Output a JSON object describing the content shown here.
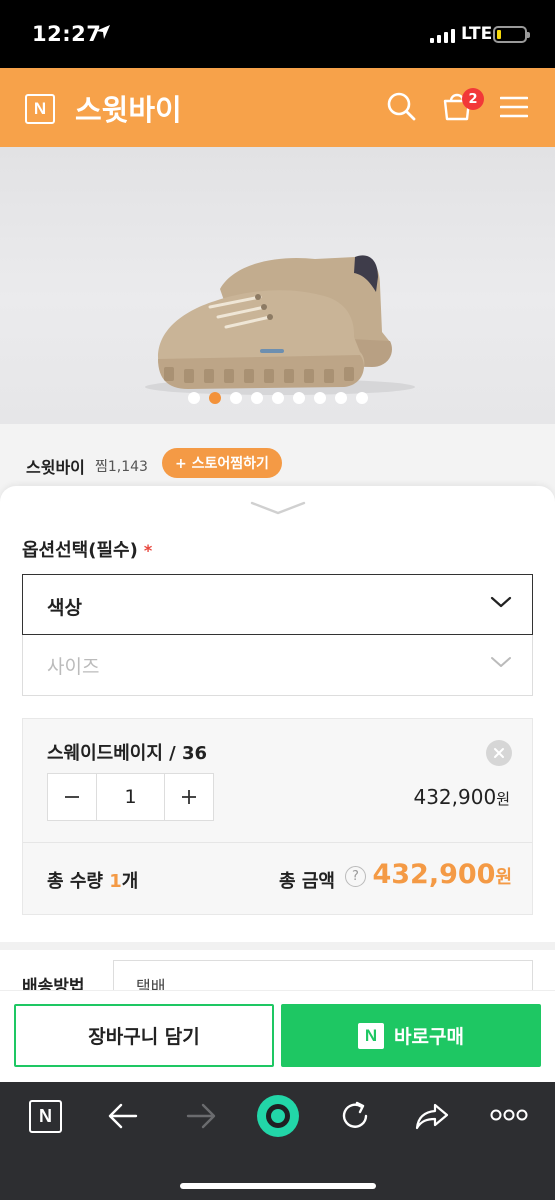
{
  "status_bar": {
    "time": "12:27",
    "network": "LTE"
  },
  "header": {
    "logo": "N",
    "title": "스윗바이",
    "cart_count": "2"
  },
  "hero": {
    "slide_count": 9,
    "active_index": 1
  },
  "store": {
    "name": "스윗바이",
    "likes": "찜1,143",
    "follow_label": "+ 스토어찜하기"
  },
  "options": {
    "title": "옵션선택(필수)",
    "required_mark": "*",
    "color_label": "색상",
    "size_label": "사이즈"
  },
  "selected_item": {
    "name": "스웨이드베이지 / 36",
    "quantity": "1",
    "price": "432,900",
    "price_unit": "원"
  },
  "totals": {
    "qty_label": "총 수량",
    "qty_value": "1",
    "qty_unit": "개",
    "amount_label": "총 금액",
    "help": "?",
    "amount": "432,900",
    "amount_unit": "원"
  },
  "shipping": {
    "label": "배송방법",
    "value": "택배"
  },
  "actions": {
    "cart_label": "장바구니 담기",
    "buy_logo": "N",
    "buy_label": "바로구매"
  },
  "browser_toolbar": {
    "logo": "N",
    "icons": [
      "naver-home-icon",
      "back-arrow-icon",
      "forward-arrow-icon",
      "green-dot-icon",
      "refresh-icon",
      "share-icon",
      "more-icon"
    ]
  },
  "colors": {
    "brand_orange": "#f7a24a",
    "accent_orange": "#f49a45",
    "naver_green": "#1ec763"
  }
}
